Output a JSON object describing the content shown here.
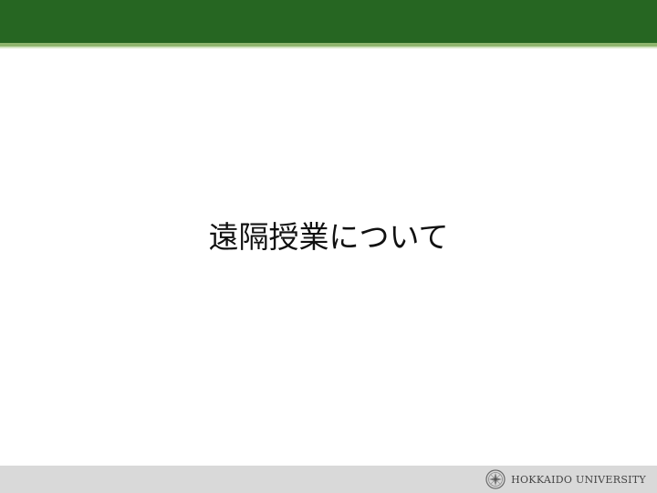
{
  "slide": {
    "title": "遠隔授業について"
  },
  "footer": {
    "university_name": "HOKKAIDO UNIVERSITY",
    "emblem_icon": "university-emblem-icon"
  },
  "colors": {
    "header_green": "#266622",
    "header_stripe": "#8fb56e",
    "footer_gray": "#d9d9d9"
  }
}
